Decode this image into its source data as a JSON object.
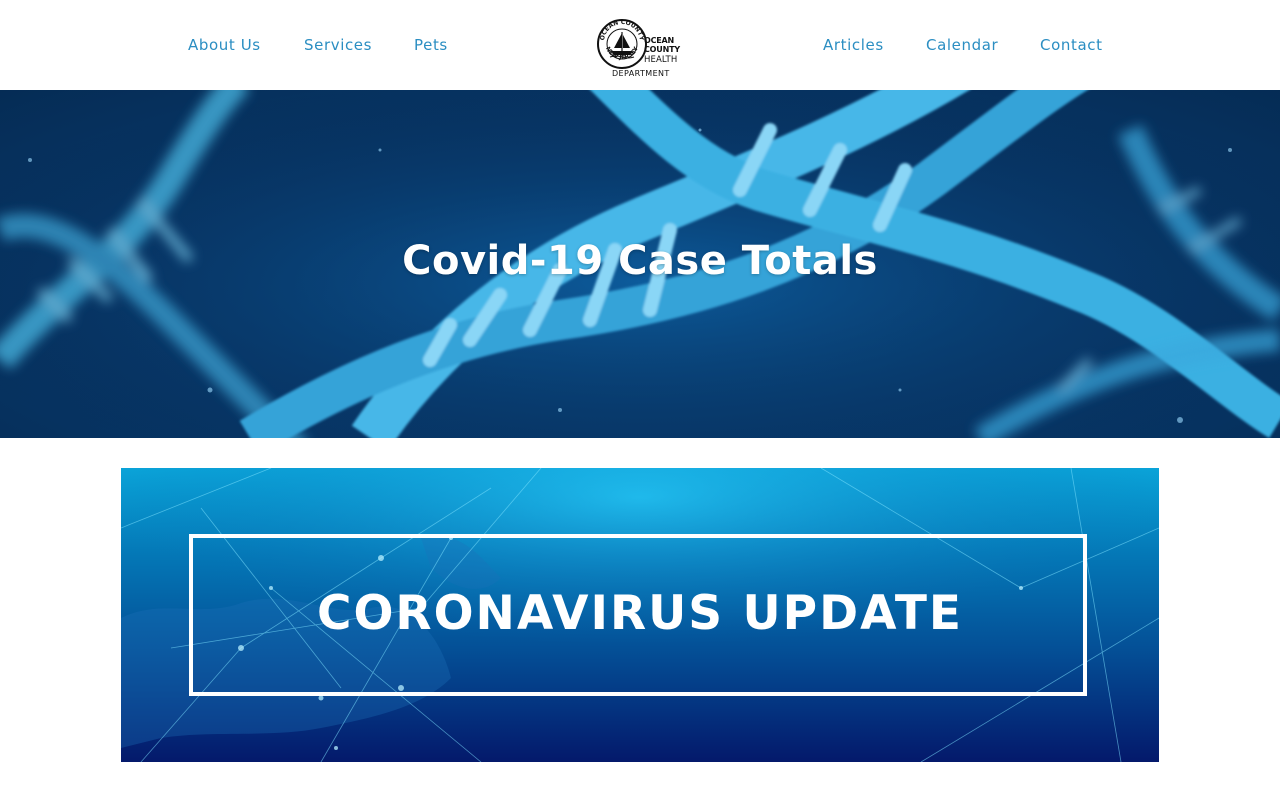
{
  "nav": {
    "left": [
      "About Us",
      "Services",
      "Pets"
    ],
    "right": [
      "Articles",
      "Calendar",
      "Contact"
    ]
  },
  "logo": {
    "seal_top": "OCEAN COUNTY",
    "seal_bottom": "NEW JERSEY",
    "line1": "OCEAN",
    "line2": "COUNTY",
    "line3": "HEALTH",
    "line4": "DEPARTMENT"
  },
  "hero": {
    "title": "Covid-19 Case Totals"
  },
  "banner": {
    "text": "CORONAVIRUS UPDATE"
  },
  "colors": {
    "nav_link": "#2b8ec2",
    "hero_bg": "#083a6e",
    "dna": "#3db4e6",
    "banner_top": "#0aa3d8",
    "banner_bottom": "#04196b"
  }
}
